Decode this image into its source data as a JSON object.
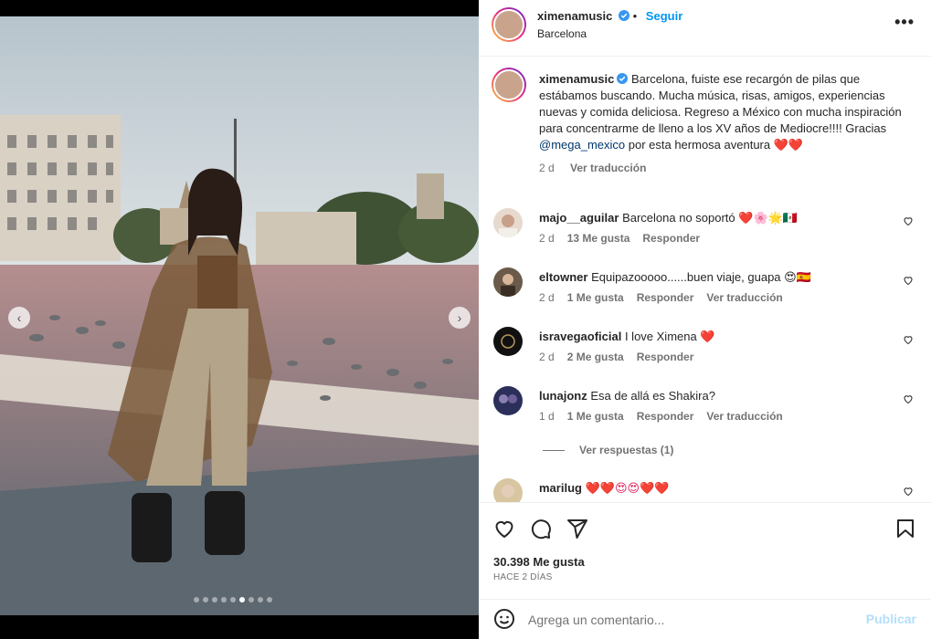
{
  "post": {
    "username": "ximenamusic",
    "follow_label": "Seguir",
    "location": "Barcelona",
    "more_label": "•••",
    "caption_before": "Barcelona, fuiste ese recargón de pilas que estábamos buscando. Mucha música, risas, amigos, experiencias nuevas y comida deliciosa. Regreso a México con mucha inspiración para concentrarme de lleno a los XV años de Mediocre!!!! Gracias ",
    "caption_mention": "@mega_mexico",
    "caption_after": " por esta hermosa aventura",
    "caption_emojis": "❤️❤️",
    "caption_time": "2 d",
    "caption_translate": "Ver traducción",
    "carousel_total": 9,
    "carousel_active": 6
  },
  "comments": [
    {
      "username": "majo__aguilar",
      "text": "Barcelona no soportó",
      "emojis": "❤️🌸🌟🇲🇽",
      "time": "2 d",
      "likes": "13 Me gusta",
      "reply": "Responder",
      "translate": ""
    },
    {
      "username": "eltowner",
      "text": "Equipazooooo......buen viaje, guapa",
      "emojis": "😍🇪🇸",
      "time": "2 d",
      "likes": "1 Me gusta",
      "reply": "Responder",
      "translate": "Ver traducción"
    },
    {
      "username": "isravegaoficial",
      "text": "I love Ximena",
      "emojis": "❤️",
      "time": "2 d",
      "likes": "2 Me gusta",
      "reply": "Responder",
      "translate": ""
    },
    {
      "username": "lunajonz",
      "text": "Esa de allá es Shakira?",
      "emojis": "",
      "time": "1 d",
      "likes": "1 Me gusta",
      "reply": "Responder",
      "translate": "Ver traducción"
    },
    {
      "username": "marilug",
      "text": "",
      "emojis": "❤️❤️😍😍❤️❤️",
      "time": "",
      "likes": "",
      "reply": "",
      "translate": ""
    }
  ],
  "view_replies": "Ver respuestas (1)",
  "actions": {
    "likes": "30.398 Me gusta",
    "posted_ago": "HACE 2 DÍAS"
  },
  "add_comment": {
    "placeholder": "Agrega un comentario...",
    "publish": "Publicar"
  },
  "icons": [
    "verified-icon",
    "heart-icon",
    "comment-icon",
    "share-icon",
    "save-icon",
    "emoji-icon",
    "chevron-left-icon",
    "chevron-right-icon",
    "more-icon"
  ],
  "colors": {
    "accent": "#0095f6",
    "verified": "#3897f0",
    "muted": "#737373",
    "heart": "#ed4956"
  }
}
